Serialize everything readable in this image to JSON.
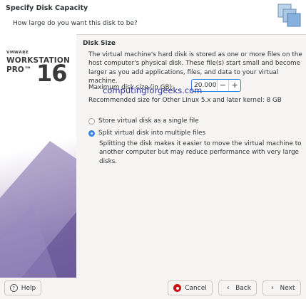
{
  "header": {
    "title": "Specify Disk Capacity",
    "subtitle": "How large do you want this disk to be?"
  },
  "brand": {
    "company": "VMWARE",
    "product": "WORKSTATION",
    "edition": "PRO™",
    "version": "16"
  },
  "disk": {
    "section_title": "Disk Size",
    "description": "The virtual machine's hard disk is stored as one or more files on the host computer's physical disk. These file(s) start small and become larger as you add applications, files, and data to your virtual machine.",
    "max_size_label": "Maximum disk size (in GB):",
    "max_size_value": "20.000",
    "decrement": "−",
    "increment": "+",
    "recommendation": "Recommended size for Other Linux 5.x and later kernel: 8 GB"
  },
  "watermark": "computingforgeeks.com",
  "options": {
    "single_label": "Store virtual disk as a single file",
    "multiple_label": "Split virtual disk into multiple files",
    "multiple_desc": "Splitting the disk makes it easier to move the virtual machine to another computer but may reduce performance with very large disks.",
    "selected": "multiple"
  },
  "footer": {
    "help": "Help",
    "cancel": "Cancel",
    "back": "Back",
    "next": "Next"
  },
  "colors": {
    "accent": "#3584e4",
    "cancel_icon": "#d01010",
    "watermark": "#2d30a0"
  }
}
